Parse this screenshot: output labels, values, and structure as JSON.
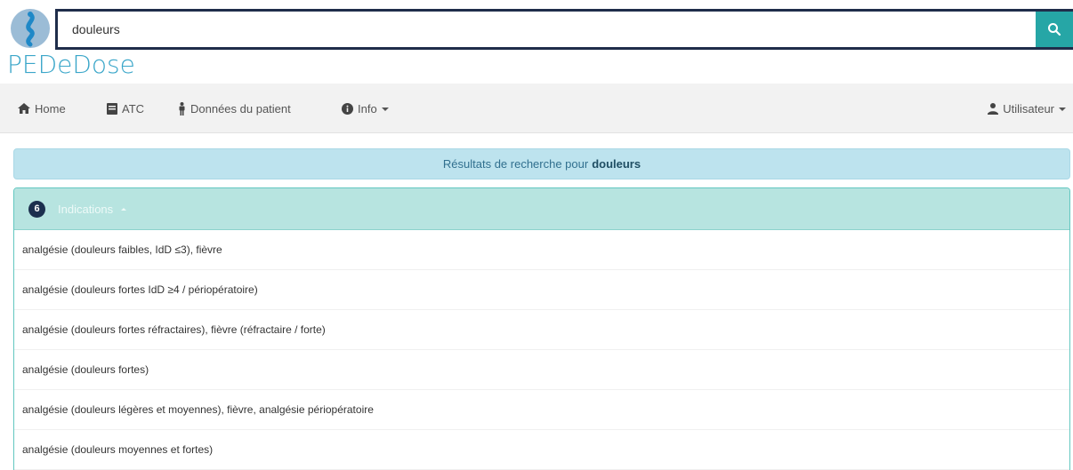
{
  "app": {
    "brand": "PEDeDose"
  },
  "search": {
    "value": "douleurs"
  },
  "navbar": {
    "items": [
      {
        "label": "Home",
        "icon": "home-icon"
      },
      {
        "label": "ATC",
        "icon": "book-icon"
      },
      {
        "label": "Données du patient",
        "icon": "person-icon"
      },
      {
        "label": "Info",
        "icon": "info-circle-icon"
      }
    ],
    "user": {
      "label": "Utilisateur",
      "icon": "user-icon"
    }
  },
  "results": {
    "prefix": "Résultats de recherche pour",
    "term": "douleurs"
  },
  "panel": {
    "count": "6",
    "title": "Indications",
    "items": [
      "analgésie (douleurs faibles, IdD ≤3), fièvre",
      "analgésie (douleurs fortes IdD ≥4 / périopératoire)",
      "analgésie (douleurs fortes réfractaires), fièvre (réfractaire / forte)",
      "analgésie (douleurs fortes)",
      "analgésie (douleurs légères et moyennes), fièvre, analgésie périopératoire",
      "analgésie (douleurs moyennes et fortes)"
    ]
  },
  "colors": {
    "accent": "#26a6a6",
    "brand": "#3aa6c9",
    "banner_bg": "#bde3ee",
    "panel_head_bg": "#b7e4e0",
    "badge_bg": "#1b2f4e"
  }
}
